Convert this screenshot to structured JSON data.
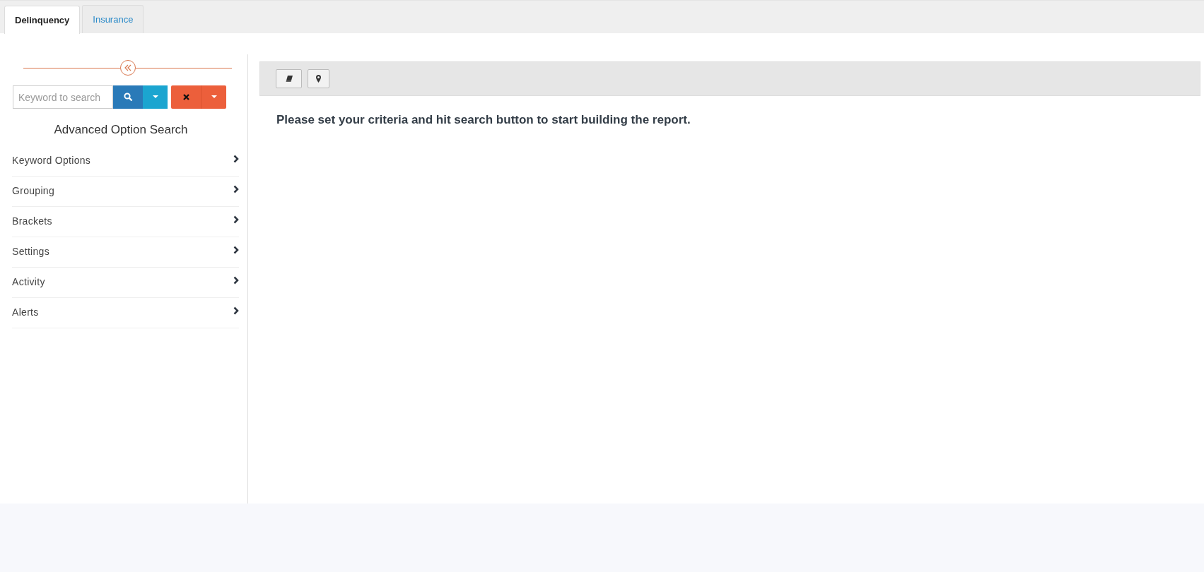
{
  "tabs": [
    {
      "label": "Delinquency",
      "selected": true
    },
    {
      "label": "Insurance",
      "selected": false
    }
  ],
  "sidebar": {
    "search": {
      "placeholder": "Keyword to search"
    },
    "title": "Advanced Option Search",
    "items": [
      {
        "label": "Keyword Options"
      },
      {
        "label": "Grouping"
      },
      {
        "label": "Brackets"
      },
      {
        "label": "Settings"
      },
      {
        "label": "Activity"
      },
      {
        "label": "Alerts"
      }
    ]
  },
  "main": {
    "message": "Please set your criteria and hit search button to start building the report."
  }
}
